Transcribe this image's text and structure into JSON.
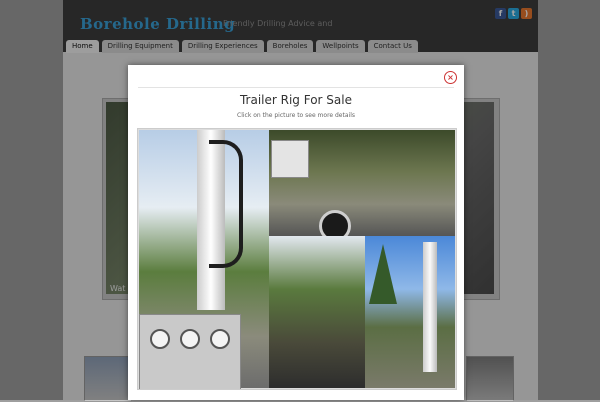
{
  "site": {
    "logo": "Borehole Drilling",
    "tagline": "Friendly Drilling Advice and",
    "social": [
      {
        "icon": "facebook-icon",
        "glyph": "f",
        "color": "#3b5998"
      },
      {
        "icon": "twitter-icon",
        "glyph": "t",
        "color": "#2aa9e0"
      },
      {
        "icon": "rss-icon",
        "glyph": ")",
        "color": "#e8772e"
      }
    ],
    "nav": [
      "Home",
      "Drilling Equipment",
      "Drilling Experiences",
      "Boreholes",
      "Wellpoints",
      "Contact Us"
    ],
    "active_nav": "Home",
    "background_caption": "Wat"
  },
  "modal": {
    "title": "Trailer Rig For Sale",
    "subtitle": "Click on the picture to see more details",
    "close_glyph": "×"
  }
}
